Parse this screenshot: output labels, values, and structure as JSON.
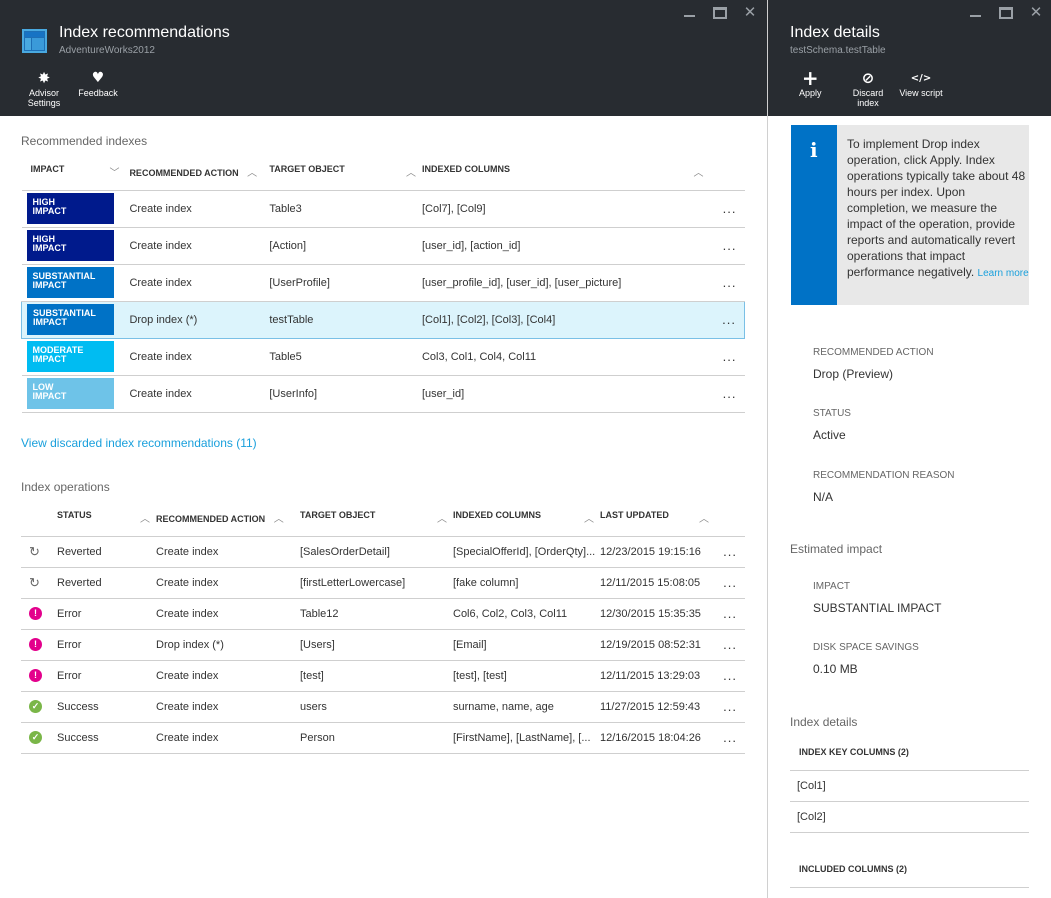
{
  "left_blade": {
    "title": "Index recommendations",
    "subtitle": "AdventureWorks2012",
    "toolbar": {
      "advisor_settings": "Advisor Settings",
      "advisor_settings_l1": "Advisor",
      "advisor_settings_l2": "Settings",
      "feedback": "Feedback"
    },
    "recommended": {
      "section_title": "Recommended indexes",
      "headers": {
        "impact": "IMPACT",
        "action": "RECOMMENDED ACTION",
        "target": "TARGET OBJECT",
        "columns": "INDEXED COLUMNS"
      },
      "rows": [
        {
          "impact_l1": "HIGH",
          "impact_l2": "IMPACT",
          "impact_color": "#001a8c",
          "action": "Create index",
          "target": "Table3",
          "columns": "[Col7], [Col9]",
          "more": "..."
        },
        {
          "impact_l1": "HIGH",
          "impact_l2": "IMPACT",
          "impact_color": "#001a8c",
          "action": "Create index",
          "target": "[Action]",
          "columns": "[user_id], [action_id]",
          "more": "..."
        },
        {
          "impact_l1": "SUBSTANTIAL",
          "impact_l2": "IMPACT",
          "impact_color": "#0072c6",
          "action": "Create index",
          "target": "[UserProfile]",
          "columns": "[user_profile_id], [user_id], [user_picture]",
          "more": "..."
        },
        {
          "impact_l1": "SUBSTANTIAL",
          "impact_l2": "IMPACT",
          "impact_color": "#0072c6",
          "action": "Drop index (*)",
          "target": "testTable",
          "columns": "[Col1], [Col2], [Col3], [Col4]",
          "more": "...",
          "selected": true
        },
        {
          "impact_l1": "MODERATE",
          "impact_l2": "IMPACT",
          "impact_color": "#00bcf2",
          "action": "Create index",
          "target": "Table5",
          "columns": "Col3, Col1, Col4, Col11",
          "more": "..."
        },
        {
          "impact_l1": "LOW",
          "impact_l2": "IMPACT",
          "impact_color": "#6ec3e8",
          "action": "Create index",
          "target": "[UserInfo]",
          "columns": "[user_id]",
          "more": "..."
        }
      ],
      "discarded_link": "View discarded index recommendations (11)"
    },
    "operations": {
      "section_title": "Index operations",
      "headers": {
        "status": "STATUS",
        "action": "RECOMMENDED ACTION",
        "target": "TARGET OBJECT",
        "columns": "INDEXED COLUMNS",
        "updated": "LAST UPDATED"
      },
      "rows": [
        {
          "status_icon": "reverted-icon",
          "status": "Reverted",
          "action": "Create index",
          "target": "[SalesOrderDetail]",
          "columns": "[SpecialOfferId], [OrderQty]...",
          "updated": "12/23/2015 19:15:16",
          "more": "..."
        },
        {
          "status_icon": "reverted-icon",
          "status": "Reverted",
          "action": "Create index",
          "target": "[firstLetterLowercase]",
          "columns": "[fake column]",
          "updated": "12/11/2015 15:08:05",
          "more": "..."
        },
        {
          "status_icon": "error-icon",
          "status": "Error",
          "action": "Create index",
          "target": "Table12",
          "columns": "Col6, Col2, Col3, Col11",
          "updated": "12/30/2015 15:35:35",
          "more": "..."
        },
        {
          "status_icon": "error-icon",
          "status": "Error",
          "action": "Drop index (*)",
          "target": "[Users]",
          "columns": "[Email]",
          "updated": "12/19/2015 08:52:31",
          "more": "..."
        },
        {
          "status_icon": "error-icon",
          "status": "Error",
          "action": "Create index",
          "target": "[test]",
          "columns": "[test], [test]",
          "updated": "12/11/2015 13:29:03",
          "more": "..."
        },
        {
          "status_icon": "success-icon",
          "status": "Success",
          "action": "Create index",
          "target": "users",
          "columns": "surname, name, age",
          "updated": "11/27/2015 12:59:43",
          "more": "..."
        },
        {
          "status_icon": "success-icon",
          "status": "Success",
          "action": "Create index",
          "target": "Person",
          "columns": "[FirstName], [LastName], [...",
          "updated": "12/16/2015 18:04:26",
          "more": "..."
        }
      ]
    }
  },
  "right_blade": {
    "title": "Index details",
    "subtitle": "testSchema.testTable",
    "toolbar": {
      "apply": "Apply",
      "discard_l1": "Discard",
      "discard_l2": "index",
      "view_script": "View script"
    },
    "info": {
      "text": "To implement Drop index operation, click Apply. Index operations typically take about 48 hours per index. Upon completion, we measure the impact of the operation, provide reports and automatically revert operations that impact performance negatively. ",
      "learn_more": "Learn more"
    },
    "properties": {
      "recommended_action_label": "RECOMMENDED ACTION",
      "recommended_action_value": "Drop (Preview)",
      "status_label": "STATUS",
      "status_value": "Active",
      "reason_label": "RECOMMENDATION REASON",
      "reason_value": "N/A"
    },
    "estimated_impact": {
      "section_title": "Estimated impact",
      "impact_label": "IMPACT",
      "impact_value": "SUBSTANTIAL IMPACT",
      "disk_label": "DISK SPACE SAVINGS",
      "disk_value": "0.10 MB"
    },
    "index_details": {
      "section_title": "Index details",
      "key_columns_header": "INDEX KEY COLUMNS (2)",
      "key_columns": [
        "[Col1]",
        "[Col2]"
      ],
      "included_columns_header": "INCLUDED COLUMNS (2)"
    }
  },
  "colors": {
    "header_bg": "#282c31",
    "accent": "#0072c6",
    "link": "#1aa0dc",
    "error": "#e3008c",
    "success": "#7ab648",
    "selected_row": "#dcf4fc"
  }
}
